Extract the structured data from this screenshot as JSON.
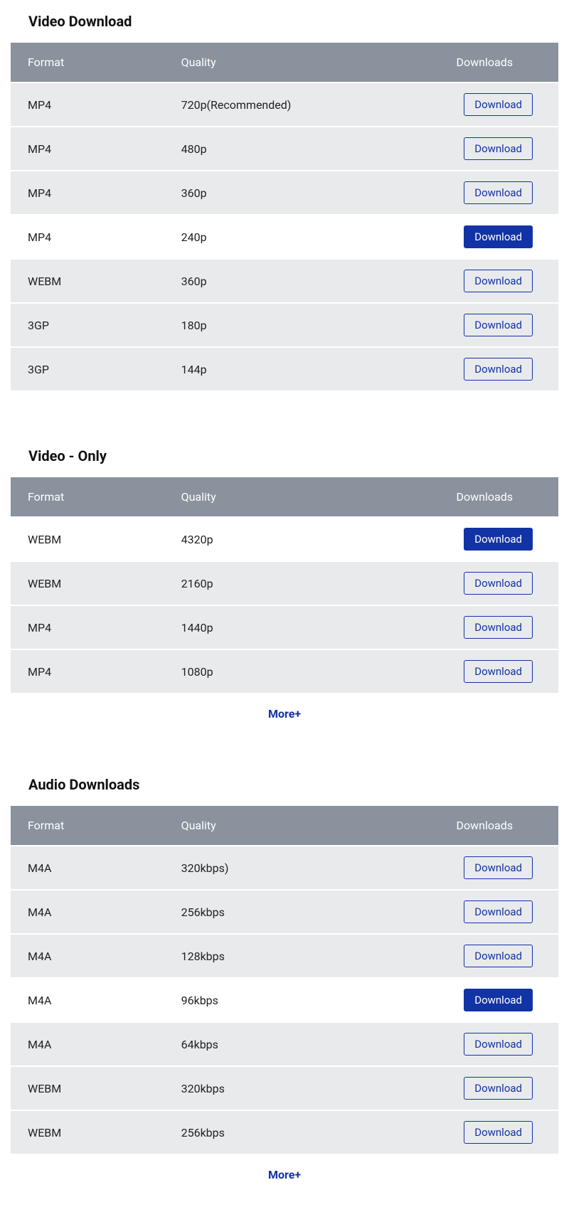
{
  "headers": {
    "format": "Format",
    "quality": "Quality",
    "downloads": "Downloads"
  },
  "buttons": {
    "download": "Download",
    "more": "More+"
  },
  "sections": [
    {
      "id": "video-download",
      "title": "Video Download",
      "show_more": false,
      "rows": [
        {
          "format": "MP4",
          "quality": "720p(Recommended)",
          "active": false
        },
        {
          "format": "MP4",
          "quality": "480p",
          "active": false
        },
        {
          "format": "MP4",
          "quality": "360p",
          "active": false
        },
        {
          "format": "MP4",
          "quality": "240p",
          "active": true
        },
        {
          "format": "WEBM",
          "quality": "360p",
          "active": false
        },
        {
          "format": "3GP",
          "quality": "180p",
          "active": false
        },
        {
          "format": "3GP",
          "quality": "144p",
          "active": false
        }
      ]
    },
    {
      "id": "video-only",
      "title": "Video - Only",
      "show_more": true,
      "rows": [
        {
          "format": "WEBM",
          "quality": "4320p",
          "active": true
        },
        {
          "format": "WEBM",
          "quality": "2160p",
          "active": false
        },
        {
          "format": "MP4",
          "quality": "1440p",
          "active": false
        },
        {
          "format": "MP4",
          "quality": "1080p",
          "active": false
        }
      ]
    },
    {
      "id": "audio-downloads",
      "title": "Audio Downloads",
      "show_more": true,
      "rows": [
        {
          "format": "M4A",
          "quality": "320kbps)",
          "active": false
        },
        {
          "format": "M4A",
          "quality": "256kbps",
          "active": false
        },
        {
          "format": "M4A",
          "quality": "128kbps",
          "active": false
        },
        {
          "format": "M4A",
          "quality": "96kbps",
          "active": true
        },
        {
          "format": "M4A",
          "quality": "64kbps",
          "active": false
        },
        {
          "format": "WEBM",
          "quality": "320kbps",
          "active": false
        },
        {
          "format": "WEBM",
          "quality": "256kbps",
          "active": false
        }
      ]
    }
  ]
}
